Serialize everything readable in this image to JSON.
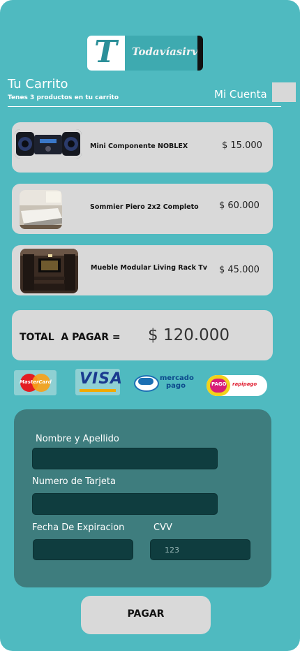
{
  "brand": {
    "letter": "T",
    "wordmark": "Todavíasirve"
  },
  "header": {
    "title": "Tu Carrito",
    "subtitle": "Tenes 3 productos en tu carrito",
    "account": "Mi Cuenta"
  },
  "cart": {
    "items": [
      {
        "name": "Mini Componente NOBLEX",
        "price": "$ 15.000",
        "image": "stereo-image"
      },
      {
        "name": "Sommier Piero 2x2 Completo",
        "price": "$ 60.000",
        "image": "bed-image"
      },
      {
        "name": "Mueble Modular Living Rack Tv",
        "price": "$ 45.000",
        "image": "tv-rack-image"
      }
    ]
  },
  "total": {
    "label": "TOTAL  A PAGAR =",
    "value": "$ 120.000"
  },
  "payment_methods": {
    "mastercard": "MasterCard",
    "visa": "VISA",
    "mercadopago_1": "mercado",
    "mercadopago_2": "pago",
    "pagofacil": "PAGO",
    "rapipago": "rapipago"
  },
  "form": {
    "name_label": "Nombre y Apellido",
    "card_label": "Numero de Tarjeta",
    "expiry_label": "Fecha De Expiracion",
    "cvv_label": "CVV",
    "cvv_placeholder": "123"
  },
  "actions": {
    "pay": "PAGAR"
  },
  "colors": {
    "background": "#4fbac0",
    "card": "#d9d9d9",
    "form": "#3e7d7e",
    "field": "#0f3d3f"
  }
}
